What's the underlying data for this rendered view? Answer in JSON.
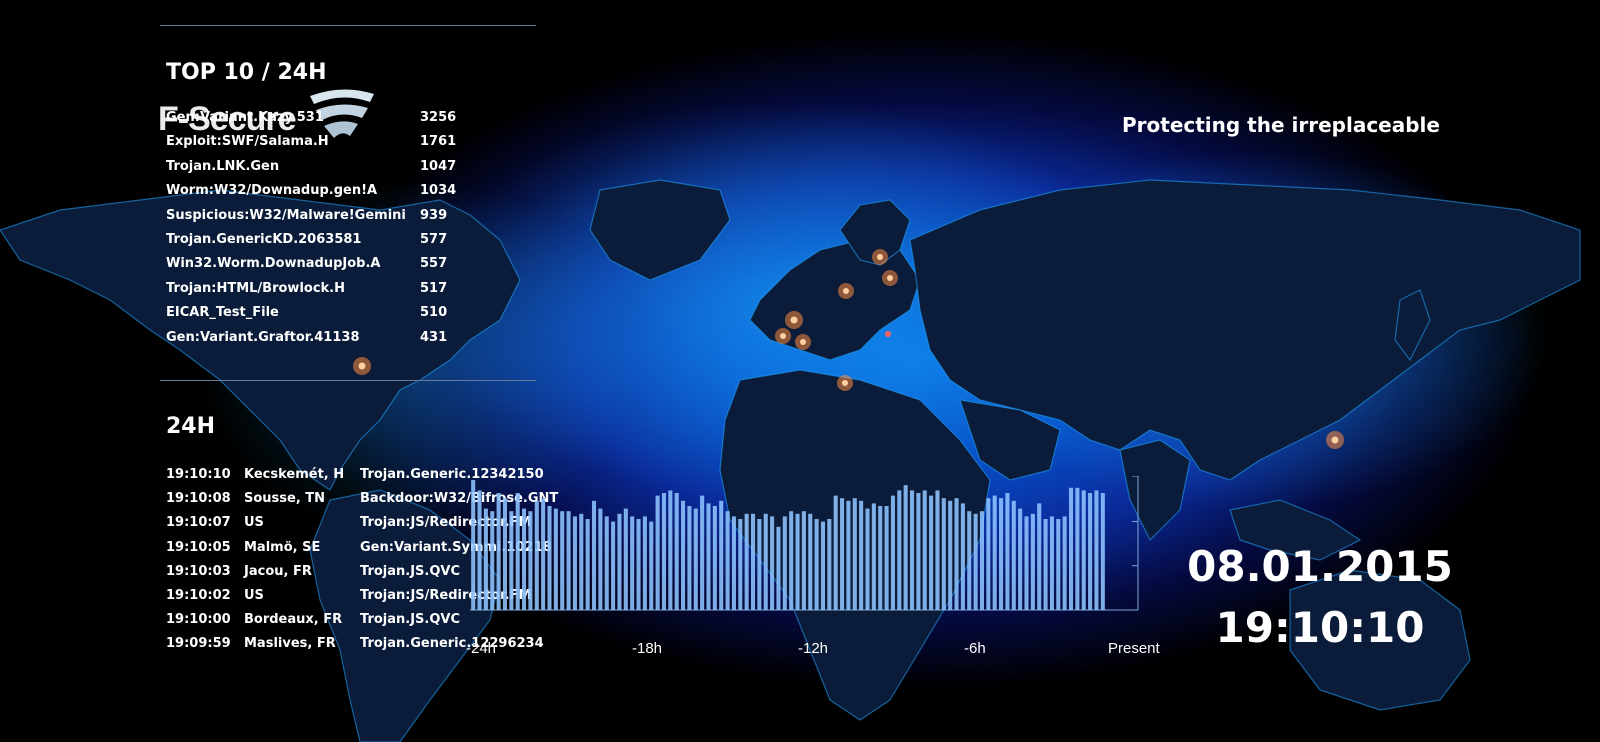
{
  "header": {
    "brand": "F-Secure",
    "tagline": "Protecting the irreplaceable"
  },
  "top10": {
    "title": "TOP 10 / 24H",
    "items": [
      {
        "name": "Gen:Variant.Kazy.531",
        "count": "3256"
      },
      {
        "name": "Exploit:SWF/Salama.H",
        "count": "1761"
      },
      {
        "name": "Trojan.LNK.Gen",
        "count": "1047"
      },
      {
        "name": "Worm:W32/Downadup.gen!A",
        "count": "1034"
      },
      {
        "name": "Suspicious:W32/Malware!Gemini",
        "count": "939"
      },
      {
        "name": "Trojan.GenericKD.2063581",
        "count": "577"
      },
      {
        "name": "Win32.Worm.DownadupJob.A",
        "count": "557"
      },
      {
        "name": "Trojan:HTML/Browlock.H",
        "count": "517"
      },
      {
        "name": "EICAR_Test_File",
        "count": "510"
      },
      {
        "name": "Gen:Variant.Graftor.41138",
        "count": "431"
      }
    ]
  },
  "feed": {
    "title": "24H",
    "items": [
      {
        "time": "19:10:10",
        "location": "Kecskemét, H",
        "threat": "Trojan.Generic.12342150"
      },
      {
        "time": "19:10:08",
        "location": "Sousse, TN",
        "threat": "Backdoor:W32/Bifrose.GNT"
      },
      {
        "time": "19:10:07",
        "location": "US",
        "threat": "Trojan:JS/Redirector.FM"
      },
      {
        "time": "19:10:05",
        "location": "Malmö, SE",
        "threat": "Gen:Variant.Symmi.10218"
      },
      {
        "time": "19:10:03",
        "location": "Jacou, FR",
        "threat": "Trojan.JS.QVC"
      },
      {
        "time": "19:10:02",
        "location": "US",
        "threat": "Trojan:JS/Redirector.FM"
      },
      {
        "time": "19:10:00",
        "location": "Bordeaux, FR",
        "threat": "Trojan.JS.QVC"
      },
      {
        "time": "19:09:59",
        "location": "Maslives, FR",
        "threat": "Trojan.Generic.12296234"
      }
    ]
  },
  "chart_data": {
    "type": "bar",
    "x_ticks": [
      "-24h",
      "-18h",
      "-12h",
      "-6h",
      "Present"
    ],
    "values": [
      100,
      92,
      78,
      76,
      90,
      86,
      76,
      90,
      78,
      76,
      84,
      86,
      80,
      78,
      76,
      76,
      72,
      74,
      70,
      84,
      78,
      72,
      68,
      74,
      78,
      72,
      70,
      72,
      68,
      88,
      90,
      92,
      90,
      84,
      80,
      78,
      88,
      82,
      80,
      84,
      76,
      72,
      70,
      74,
      74,
      70,
      74,
      72,
      64,
      72,
      76,
      74,
      76,
      74,
      70,
      68,
      70,
      88,
      86,
      84,
      86,
      84,
      78,
      82,
      80,
      80,
      88,
      92,
      96,
      92,
      90,
      92,
      88,
      92,
      86,
      84,
      86,
      82,
      76,
      74,
      76,
      86,
      88,
      86,
      90,
      84,
      78,
      72,
      74,
      82,
      70,
      72,
      70,
      72,
      94,
      94,
      92,
      90,
      92,
      90
    ],
    "bar_color": "#8ec4ff",
    "marker_color": "#f2a03a"
  },
  "clock": {
    "date": "08.01.2015",
    "time": "19:10:10"
  },
  "colors": {
    "map_land": "#0b1c3a",
    "glow": "#0a6fe0",
    "hotspot": "#ff8a3a"
  }
}
